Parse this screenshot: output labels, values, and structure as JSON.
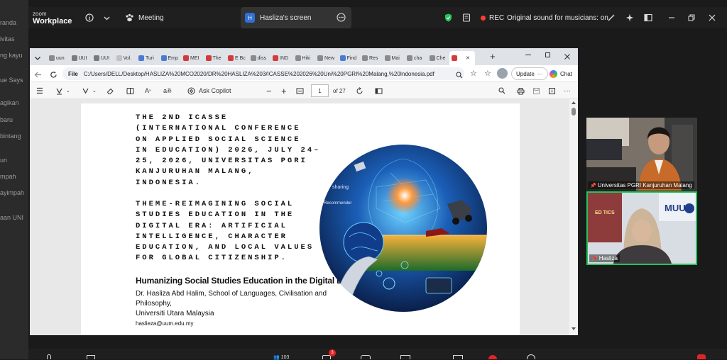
{
  "left_strip": {
    "fragments": [
      "randa",
      "ivitas",
      "ng kayu",
      "ue Says",
      "agikan",
      "baru",
      "bintang",
      "un",
      "mpah",
      "ayimpah",
      "aan UNI"
    ]
  },
  "zoom": {
    "logo_top": "zoom",
    "logo_bottom": "Workplace",
    "meeting_label": "Meeting",
    "screen_tab_badge": "H",
    "screen_tab_label": "Hasliza's screen",
    "rec_label": "REC",
    "sound_label": "Original sound for musicians: on"
  },
  "browser": {
    "tabs": [
      "uun",
      "UUI",
      "UUI",
      "Vol.",
      "Turi",
      "Emp",
      "MEI",
      "The",
      "E Bc",
      "diss",
      "IND",
      "Hiki",
      "New",
      "Find",
      "Res",
      "Mai",
      "cha",
      "Che",
      ""
    ],
    "url_prefix": "File",
    "url": "C:/Users/DELL/Desktop/HASLIZA%20MCO2020/DR%20HASLIZA%203/ICASSE%202026%20Uni%20PGRI%20Malang,%20Indonesia.pdf",
    "update_label": "Update",
    "chat_label": "Chat"
  },
  "pdf_toolbar": {
    "copilot_label": "Ask Copilot",
    "page_current": "1",
    "page_total": "of 27"
  },
  "pdf": {
    "title_lines": [
      "THE 2ND ICASSE",
      "(INTERNATIONAL CONFERENCE",
      "ON APPLIED SOCIAL SCIENCE",
      "IN EDUCATION) 2026, JULY 24–",
      "25, 2026, UNIVERSITAS PGRI",
      "KANJURUHAN MALANG,",
      "INDONESIA."
    ],
    "theme_lines": [
      "THEME-REIMAGINING SOCIAL",
      "STUDIES EDUCATION IN THE",
      "DIGITAL ERA: ARTIFICIAL",
      "INTELLIGENCE, CHARACTER",
      "EDUCATION, AND LOCAL VALUES",
      "FOR GLOBAL CITIZENSHIP."
    ],
    "subtitle": "Humanizing Social Studies Education in the Digital Era",
    "author_line1": "Dr. Hasliza Abd Halim, School of Languages, Civilisation and",
    "author_line2": "Philosophy,",
    "university": "Universiti Utara Malaysia",
    "email": "haslieza@uum.edu.my",
    "image_words": [
      "sharing",
      "Recommender"
    ]
  },
  "participants": [
    {
      "name": "Universitas PGRI Kanjuruhan Malang"
    },
    {
      "name": "Hasliza",
      "logo_text": "MUU",
      "banner_text": "ED TICS"
    }
  ],
  "bottom_bar": {
    "badge": "3",
    "count": "103"
  }
}
